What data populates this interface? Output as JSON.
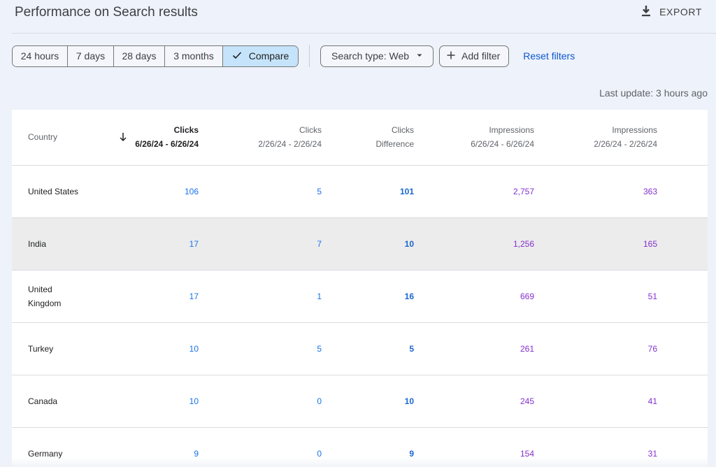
{
  "header": {
    "title": "Performance on Search results",
    "export_label": "EXPORT"
  },
  "toolbar": {
    "date_ranges": [
      "24 hours",
      "7 days",
      "28 days",
      "3 months"
    ],
    "compare_label": "Compare",
    "search_type_label": "Search type: Web",
    "add_filter_label": "Add filter",
    "reset_filters_label": "Reset filters"
  },
  "status": {
    "last_update": "Last update: 3 hours ago"
  },
  "table": {
    "columns": [
      {
        "line1": "Country",
        "line2": ""
      },
      {
        "line1": "Clicks",
        "line2": "6/26/24 - 6/26/24"
      },
      {
        "line1": "Clicks",
        "line2": "2/26/24 - 2/26/24"
      },
      {
        "line1": "Clicks",
        "line2": "Difference"
      },
      {
        "line1": "Impressions",
        "line2": "6/26/24 - 6/26/24"
      },
      {
        "line1": "Impressions",
        "line2": "2/26/24 - 2/26/24"
      }
    ],
    "rows": [
      {
        "country": "United States",
        "clicks_current": "106",
        "clicks_previous": "5",
        "clicks_diff": "101",
        "impr_current": "2,757",
        "impr_previous": "363"
      },
      {
        "country": "India",
        "clicks_current": "17",
        "clicks_previous": "7",
        "clicks_diff": "10",
        "impr_current": "1,256",
        "impr_previous": "165"
      },
      {
        "country": "United Kingdom",
        "clicks_current": "17",
        "clicks_previous": "1",
        "clicks_diff": "16",
        "impr_current": "669",
        "impr_previous": "51"
      },
      {
        "country": "Turkey",
        "clicks_current": "10",
        "clicks_previous": "5",
        "clicks_diff": "5",
        "impr_current": "261",
        "impr_previous": "76"
      },
      {
        "country": "Canada",
        "clicks_current": "10",
        "clicks_previous": "0",
        "clicks_diff": "10",
        "impr_current": "245",
        "impr_previous": "41"
      },
      {
        "country": "Germany",
        "clicks_current": "9",
        "clicks_previous": "0",
        "clicks_diff": "9",
        "impr_current": "154",
        "impr_previous": "31"
      }
    ]
  },
  "colors": {
    "accent": "#1a73e8",
    "impressions": "#8430ce",
    "compare_active_bg": "#c5e4fb",
    "link": "#0b57d0"
  },
  "icons": {
    "export": "download-icon",
    "compare": "checkmark-icon",
    "search_type": "caret-down-icon",
    "add_filter": "plus-icon",
    "sort": "arrow-down-icon"
  }
}
